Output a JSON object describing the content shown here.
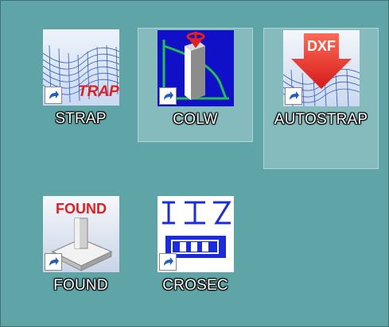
{
  "desktop": {
    "icons": [
      {
        "label": "STRAP",
        "icon": "strap-icon",
        "badge": "TRAP"
      },
      {
        "label": "COLW",
        "icon": "colw-icon"
      },
      {
        "label": "AUTOSTRAP",
        "icon": "autostrap-icon",
        "badge": "DXF"
      },
      {
        "label": "FOUND",
        "icon": "found-icon",
        "badge": "FOUND"
      },
      {
        "label": "CROSEC",
        "icon": "crosec-icon"
      }
    ]
  },
  "colors": {
    "desktop_background": "#5fa4a6",
    "selection": "#d6ecec",
    "accent_red": "#e02020",
    "accent_blue": "#1a2be0"
  }
}
